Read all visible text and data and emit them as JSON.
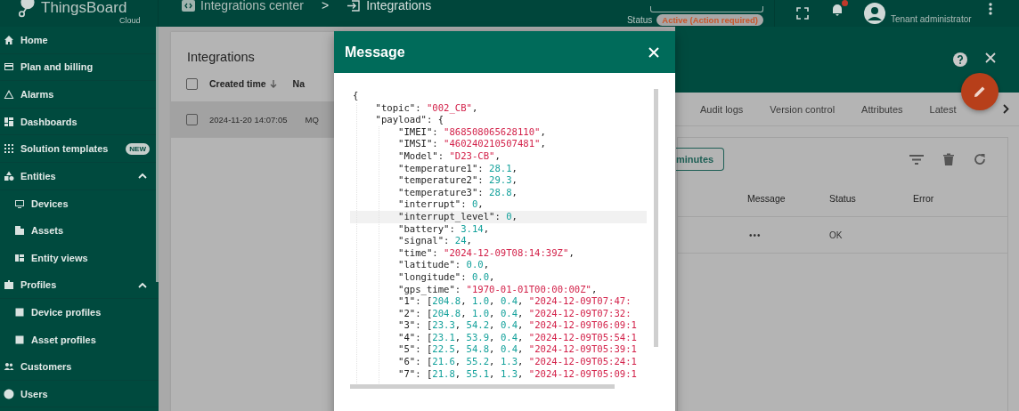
{
  "topbar": {
    "logo": "ThingsBoard",
    "logo_sub": "Cloud",
    "breadcrumb": [
      "Integrations center",
      ">",
      "Integrations"
    ],
    "status_label": "Status",
    "status": "Active (Action required)",
    "user_role": "Tenant administrator",
    "notification_dot": true
  },
  "sidebar": {
    "items": [
      {
        "label": "Home"
      },
      {
        "label": "Plan and billing"
      },
      {
        "label": "Alarms"
      },
      {
        "label": "Dashboards"
      },
      {
        "label": "Solution templates",
        "badge": "NEW"
      },
      {
        "label": "Entities",
        "expanded": true,
        "children": [
          {
            "label": "Devices"
          },
          {
            "label": "Assets"
          },
          {
            "label": "Entity views"
          }
        ]
      },
      {
        "label": "Profiles",
        "expanded": true,
        "children": [
          {
            "label": "Device profiles"
          },
          {
            "label": "Asset profiles"
          }
        ]
      },
      {
        "label": "Customers"
      },
      {
        "label": "Users"
      }
    ]
  },
  "integrations": {
    "title": "Integrations",
    "select_all_checked": false,
    "columns": [
      "Created time",
      "Na"
    ],
    "rows": [
      {
        "selected": true,
        "checked": false,
        "cells": [
          "2024-11-20 14:07:05",
          "MQ"
        ]
      }
    ]
  },
  "details": {
    "tabs": [
      "Audit logs",
      "Version control",
      "Attributes",
      "Latest"
    ],
    "time_button": "minutes",
    "columns": [
      "Message",
      "Status",
      "Error"
    ],
    "rows": [
      {
        "message": "•••",
        "status": "OK"
      }
    ]
  },
  "dialog": {
    "title": "Message",
    "lines": [
      {
        "highlighted": false,
        "parts": [
          {
            "kind": "punct",
            "text": "{"
          }
        ]
      },
      {
        "highlighted": false,
        "parts": [
          {
            "kind": "key",
            "text": "    \"topic\""
          },
          {
            "kind": "punct",
            "text": ": "
          },
          {
            "kind": "string",
            "text": "\"002_CB\""
          },
          {
            "kind": "punct",
            "text": ","
          }
        ]
      },
      {
        "highlighted": false,
        "parts": [
          {
            "kind": "key",
            "text": "    \"payload\""
          },
          {
            "kind": "punct",
            "text": ": {"
          }
        ]
      },
      {
        "highlighted": false,
        "parts": [
          {
            "kind": "key",
            "text": "        \"IMEI\""
          },
          {
            "kind": "punct",
            "text": ": "
          },
          {
            "kind": "string",
            "text": "\"868508065628110\""
          },
          {
            "kind": "punct",
            "text": ","
          }
        ]
      },
      {
        "highlighted": false,
        "parts": [
          {
            "kind": "key",
            "text": "        \"IMSI\""
          },
          {
            "kind": "punct",
            "text": ": "
          },
          {
            "kind": "string",
            "text": "\"460240210507481\""
          },
          {
            "kind": "punct",
            "text": ","
          }
        ]
      },
      {
        "highlighted": false,
        "parts": [
          {
            "kind": "key",
            "text": "        \"Model\""
          },
          {
            "kind": "punct",
            "text": ": "
          },
          {
            "kind": "string",
            "text": "\"D23-CB\""
          },
          {
            "kind": "punct",
            "text": ","
          }
        ]
      },
      {
        "highlighted": false,
        "parts": [
          {
            "kind": "key",
            "text": "        \"temperature1\""
          },
          {
            "kind": "punct",
            "text": ": "
          },
          {
            "kind": "number",
            "text": "28.1"
          },
          {
            "kind": "punct",
            "text": ","
          }
        ]
      },
      {
        "highlighted": false,
        "parts": [
          {
            "kind": "key",
            "text": "        \"temperature2\""
          },
          {
            "kind": "punct",
            "text": ": "
          },
          {
            "kind": "number",
            "text": "29.3"
          },
          {
            "kind": "punct",
            "text": ","
          }
        ]
      },
      {
        "highlighted": false,
        "parts": [
          {
            "kind": "key",
            "text": "        \"temperature3\""
          },
          {
            "kind": "punct",
            "text": ": "
          },
          {
            "kind": "number",
            "text": "28.8"
          },
          {
            "kind": "punct",
            "text": ","
          }
        ]
      },
      {
        "highlighted": false,
        "parts": [
          {
            "kind": "key",
            "text": "        \"interrupt\""
          },
          {
            "kind": "punct",
            "text": ": "
          },
          {
            "kind": "number",
            "text": "0"
          },
          {
            "kind": "punct",
            "text": ","
          }
        ]
      },
      {
        "highlighted": true,
        "parts": [
          {
            "kind": "key",
            "text": "        \"interrupt_level\""
          },
          {
            "kind": "punct",
            "text": ": "
          },
          {
            "kind": "number",
            "text": "0"
          },
          {
            "kind": "punct",
            "text": ","
          }
        ]
      },
      {
        "highlighted": false,
        "parts": [
          {
            "kind": "key",
            "text": "        \"battery\""
          },
          {
            "kind": "punct",
            "text": ": "
          },
          {
            "kind": "number",
            "text": "3.14"
          },
          {
            "kind": "punct",
            "text": ","
          }
        ]
      },
      {
        "highlighted": false,
        "parts": [
          {
            "kind": "key",
            "text": "        \"signal\""
          },
          {
            "kind": "punct",
            "text": ": "
          },
          {
            "kind": "number",
            "text": "24"
          },
          {
            "kind": "punct",
            "text": ","
          }
        ]
      },
      {
        "highlighted": false,
        "parts": [
          {
            "kind": "key",
            "text": "        \"time\""
          },
          {
            "kind": "punct",
            "text": ": "
          },
          {
            "kind": "string",
            "text": "\"2024-12-09T08:14:39Z\""
          },
          {
            "kind": "punct",
            "text": ","
          }
        ]
      },
      {
        "highlighted": false,
        "parts": [
          {
            "kind": "key",
            "text": "        \"latitude\""
          },
          {
            "kind": "punct",
            "text": ": "
          },
          {
            "kind": "number",
            "text": "0.0"
          },
          {
            "kind": "punct",
            "text": ","
          }
        ]
      },
      {
        "highlighted": false,
        "parts": [
          {
            "kind": "key",
            "text": "        \"longitude\""
          },
          {
            "kind": "punct",
            "text": ": "
          },
          {
            "kind": "number",
            "text": "0.0"
          },
          {
            "kind": "punct",
            "text": ","
          }
        ]
      },
      {
        "highlighted": false,
        "parts": [
          {
            "kind": "key",
            "text": "        \"gps_time\""
          },
          {
            "kind": "punct",
            "text": ": "
          },
          {
            "kind": "string",
            "text": "\"1970-01-01T00:00:00Z\""
          },
          {
            "kind": "punct",
            "text": ","
          }
        ]
      },
      {
        "highlighted": false,
        "parts": [
          {
            "kind": "key",
            "text": "        \"1\""
          },
          {
            "kind": "punct",
            "text": ": ["
          },
          {
            "kind": "number",
            "text": "204.8"
          },
          {
            "kind": "punct",
            "text": ", "
          },
          {
            "kind": "number",
            "text": "1.0"
          },
          {
            "kind": "punct",
            "text": ", "
          },
          {
            "kind": "number",
            "text": "0.4"
          },
          {
            "kind": "punct",
            "text": ", "
          },
          {
            "kind": "string",
            "text": "\"2024-12-09T07:47:"
          }
        ]
      },
      {
        "highlighted": false,
        "parts": [
          {
            "kind": "key",
            "text": "        \"2\""
          },
          {
            "kind": "punct",
            "text": ": ["
          },
          {
            "kind": "number",
            "text": "204.8"
          },
          {
            "kind": "punct",
            "text": ", "
          },
          {
            "kind": "number",
            "text": "1.0"
          },
          {
            "kind": "punct",
            "text": ", "
          },
          {
            "kind": "number",
            "text": "0.4"
          },
          {
            "kind": "punct",
            "text": ", "
          },
          {
            "kind": "string",
            "text": "\"2024-12-09T07:32:"
          }
        ]
      },
      {
        "highlighted": false,
        "parts": [
          {
            "kind": "key",
            "text": "        \"3\""
          },
          {
            "kind": "punct",
            "text": ": ["
          },
          {
            "kind": "number",
            "text": "23.3"
          },
          {
            "kind": "punct",
            "text": ", "
          },
          {
            "kind": "number",
            "text": "54.2"
          },
          {
            "kind": "punct",
            "text": ", "
          },
          {
            "kind": "number",
            "text": "0.4"
          },
          {
            "kind": "punct",
            "text": ", "
          },
          {
            "kind": "string",
            "text": "\"2024-12-09T06:09:1"
          }
        ]
      },
      {
        "highlighted": false,
        "parts": [
          {
            "kind": "key",
            "text": "        \"4\""
          },
          {
            "kind": "punct",
            "text": ": ["
          },
          {
            "kind": "number",
            "text": "23.1"
          },
          {
            "kind": "punct",
            "text": ", "
          },
          {
            "kind": "number",
            "text": "53.9"
          },
          {
            "kind": "punct",
            "text": ", "
          },
          {
            "kind": "number",
            "text": "0.4"
          },
          {
            "kind": "punct",
            "text": ", "
          },
          {
            "kind": "string",
            "text": "\"2024-12-09T05:54:1"
          }
        ]
      },
      {
        "highlighted": false,
        "parts": [
          {
            "kind": "key",
            "text": "        \"5\""
          },
          {
            "kind": "punct",
            "text": ": ["
          },
          {
            "kind": "number",
            "text": "22.5"
          },
          {
            "kind": "punct",
            "text": ", "
          },
          {
            "kind": "number",
            "text": "54.8"
          },
          {
            "kind": "punct",
            "text": ", "
          },
          {
            "kind": "number",
            "text": "0.4"
          },
          {
            "kind": "punct",
            "text": ", "
          },
          {
            "kind": "string",
            "text": "\"2024-12-09T05:39:1"
          }
        ]
      },
      {
        "highlighted": false,
        "parts": [
          {
            "kind": "key",
            "text": "        \"6\""
          },
          {
            "kind": "punct",
            "text": ": ["
          },
          {
            "kind": "number",
            "text": "21.6"
          },
          {
            "kind": "punct",
            "text": ", "
          },
          {
            "kind": "number",
            "text": "55.2"
          },
          {
            "kind": "punct",
            "text": ", "
          },
          {
            "kind": "number",
            "text": "1.3"
          },
          {
            "kind": "punct",
            "text": ", "
          },
          {
            "kind": "string",
            "text": "\"2024-12-09T05:24:1"
          }
        ]
      },
      {
        "highlighted": false,
        "parts": [
          {
            "kind": "key",
            "text": "        \"7\""
          },
          {
            "kind": "punct",
            "text": ": ["
          },
          {
            "kind": "number",
            "text": "21.8"
          },
          {
            "kind": "punct",
            "text": ", "
          },
          {
            "kind": "number",
            "text": "55.1"
          },
          {
            "kind": "punct",
            "text": ", "
          },
          {
            "kind": "number",
            "text": "1.3"
          },
          {
            "kind": "punct",
            "text": ", "
          },
          {
            "kind": "string",
            "text": "\"2024-12-09T05:09:1"
          }
        ]
      }
    ]
  }
}
